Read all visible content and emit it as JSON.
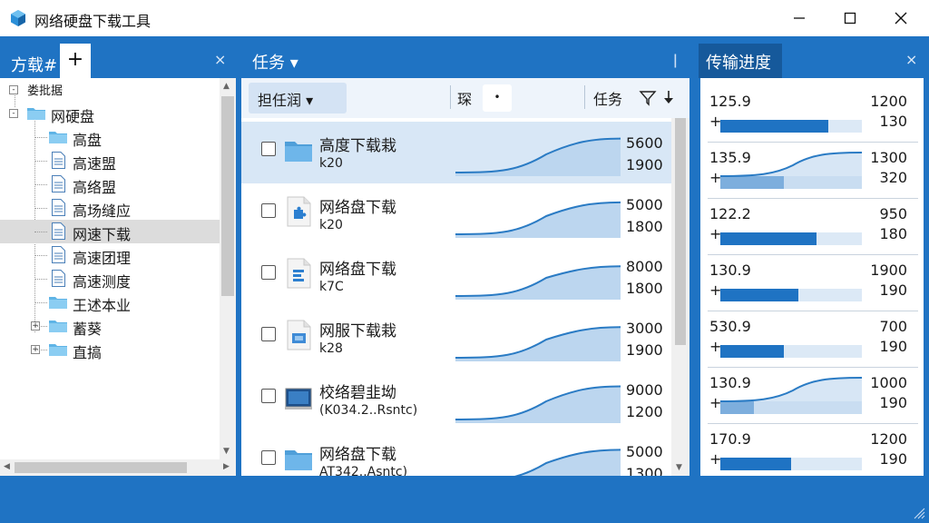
{
  "app": {
    "title": "网络硬盘下载工具",
    "icon": "cube-icon"
  },
  "window_controls": {
    "minimize": "minimize-icon",
    "maximize": "maximize-icon",
    "close": "close-icon"
  },
  "left_panel": {
    "tab_label": "方载#",
    "add_tab": "+",
    "close": "×",
    "tree": [
      {
        "label": "娄批据",
        "level": 0,
        "icon": "none",
        "expander": "-"
      },
      {
        "label": "网硬盘",
        "level": 0,
        "icon": "folder",
        "expander": "-"
      },
      {
        "label": "高盘",
        "level": 1,
        "icon": "folder",
        "expander": ""
      },
      {
        "label": "高速盟",
        "level": 1,
        "icon": "document",
        "expander": ""
      },
      {
        "label": "高络盟",
        "level": 1,
        "icon": "document",
        "expander": ""
      },
      {
        "label": "高场缝应",
        "level": 1,
        "icon": "document",
        "expander": ""
      },
      {
        "label": "网速下载",
        "level": 1,
        "icon": "document",
        "expander": "",
        "selected": true
      },
      {
        "label": "高速团理",
        "level": 1,
        "icon": "document",
        "expander": ""
      },
      {
        "label": "高速测度",
        "level": 1,
        "icon": "document",
        "expander": ""
      },
      {
        "label": "王述本业",
        "level": 1,
        "icon": "folder",
        "expander": ""
      },
      {
        "label": "蓄葵",
        "level": 1,
        "icon": "folder",
        "expander": "+"
      },
      {
        "label": "直搞",
        "level": 1,
        "icon": "folder",
        "expander": "+"
      }
    ]
  },
  "middle_panel": {
    "tab_label": "任务 ▾",
    "pin": "ǀ",
    "toolbar": {
      "dropdown_label": "担任润 ▾",
      "label2": "琛",
      "small_btn": "•",
      "label3": "任务",
      "filter_icon": "filter-icon",
      "sort_icon": "sort-down-icon"
    },
    "tasks": [
      {
        "name": "高度下载栽",
        "sub": "k20",
        "value1": "5600",
        "value2": "1900",
        "icon": "folder",
        "selected": true,
        "progress": 0.9
      },
      {
        "name": "网络盘下载",
        "sub": "k20",
        "value1": "5000",
        "value2": "1800",
        "icon": "puzzle-doc",
        "progress": 0.85
      },
      {
        "name": "网络盘下载",
        "sub": "k7C",
        "value1": "8000",
        "value2": "1800",
        "icon": "lines-doc",
        "progress": 0.8
      },
      {
        "name": "网服下载栽",
        "sub": "k28",
        "value1": "3000",
        "value2": "1900",
        "icon": "image-doc",
        "progress": 0.82
      },
      {
        "name": "校络碧韭坳",
        "sub": "(K034.2..Rsntc)",
        "value1": "9000",
        "value2": "1200",
        "icon": "monitor",
        "progress": 0.88
      },
      {
        "name": "网络盘下载",
        "sub": "AT342..Asntc)",
        "value1": "5000",
        "value2": "1300",
        "icon": "folder",
        "progress": 0.84
      }
    ]
  },
  "right_panel": {
    "tab_label": "传输进度",
    "close": "×",
    "rows": [
      {
        "label": "125.9",
        "plus": "+",
        "value1": "1200",
        "value2": "130",
        "progress": 0.76,
        "curve": false
      },
      {
        "label": "135.9",
        "plus": "+",
        "value1": "1300",
        "value2": "320",
        "progress": 0.45,
        "curve": true
      },
      {
        "label": "122.2",
        "plus": "+",
        "value1": "950",
        "value2": "180",
        "progress": 0.68,
        "curve": false
      },
      {
        "label": "130.9",
        "plus": "+",
        "value1": "1900",
        "value2": "190",
        "progress": 0.55,
        "curve": false
      },
      {
        "label": "530.9",
        "plus": "+",
        "value1": "700",
        "value2": "190",
        "progress": 0.45,
        "curve": false
      },
      {
        "label": "130.9",
        "plus": "+",
        "value1": "1000",
        "value2": "190",
        "progress": 0.24,
        "curve": true
      },
      {
        "label": "170.9",
        "plus": "+",
        "value1": "1200",
        "value2": "190",
        "progress": 0.5,
        "curve": false
      }
    ]
  },
  "colors": {
    "accent": "#1f73c3",
    "accent_dark": "#16599b",
    "selection": "#d8e7f6",
    "chart_fill": "#bcd6ef",
    "chart_line": "#2a7bc4"
  }
}
